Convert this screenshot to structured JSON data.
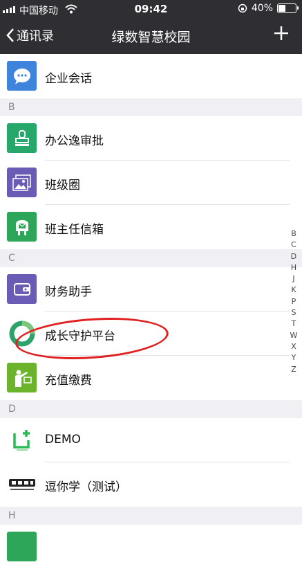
{
  "status": {
    "carrier": "中国移动",
    "time": "09:42",
    "battery": "40%",
    "battery_level": 0.4
  },
  "nav": {
    "back_label": "通讯录",
    "title": "绿数智慧校园",
    "add_icon": "plus-icon"
  },
  "list": {
    "item_wechat": {
      "label": "企业会话",
      "icon": "chat-bubble-icon",
      "color": "#3f84dc"
    },
    "section_b": "B",
    "item_approve": {
      "label": "办公逸审批",
      "icon": "stamp-icon",
      "color": "#26a86b"
    },
    "item_class": {
      "label": "班级圈",
      "icon": "photo-gallery-icon",
      "color": "#6a5bb5"
    },
    "item_mailbox": {
      "label": "班主任信箱",
      "icon": "mailbox-icon",
      "color": "#2ea65a"
    },
    "section_c": "C",
    "item_finance": {
      "label": "财务助手",
      "icon": "wallet-icon",
      "color": "#6a5bb5"
    },
    "item_guard": {
      "label": "成长守护平台",
      "icon": "guard-logo-icon",
      "color": "#2ba36a"
    },
    "item_pay": {
      "label": "充值缴费",
      "icon": "teacher-board-icon",
      "color": "#6bb32a"
    },
    "section_d": "D",
    "item_demo": {
      "label": "DEMO",
      "icon": "demo-logo-icon",
      "color": "#2dbb55"
    },
    "item_doni": {
      "label": "逗你学（测试）",
      "icon": "doni-logo-icon",
      "color": "#222222"
    },
    "section_h": "H"
  },
  "index_letters": [
    "B",
    "C",
    "D",
    "H",
    "J",
    "K",
    "P",
    "S",
    "T",
    "W",
    "X",
    "Y",
    "Z"
  ]
}
